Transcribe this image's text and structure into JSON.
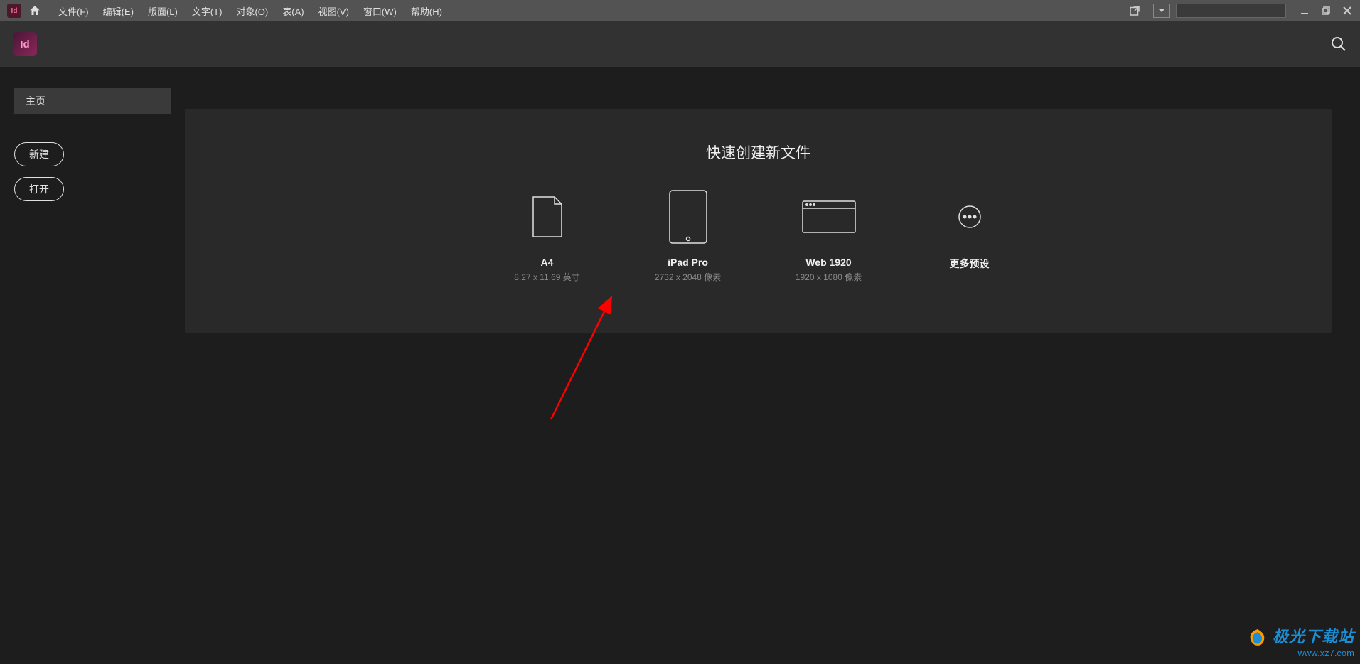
{
  "menu": {
    "items": [
      "文件(F)",
      "编辑(E)",
      "版面(L)",
      "文字(T)",
      "对象(O)",
      "表(A)",
      "视图(V)",
      "窗口(W)",
      "帮助(H)"
    ]
  },
  "app": {
    "logoText": "Id",
    "badgeText": "Id"
  },
  "sidebar": {
    "homeTab": "主页",
    "newButton": "新建",
    "openButton": "打开"
  },
  "quickCreate": {
    "title": "快速创建新文件",
    "presets": [
      {
        "label": "A4",
        "dims": "8.27 x 11.69 英寸"
      },
      {
        "label": "iPad Pro",
        "dims": "2732 x 2048 像素"
      },
      {
        "label": "Web 1920",
        "dims": "1920 x 1080 像素"
      },
      {
        "label": "更多预设",
        "dims": ""
      }
    ]
  },
  "watermark": {
    "title": "极光下载站",
    "url": "www.xz7.com"
  }
}
